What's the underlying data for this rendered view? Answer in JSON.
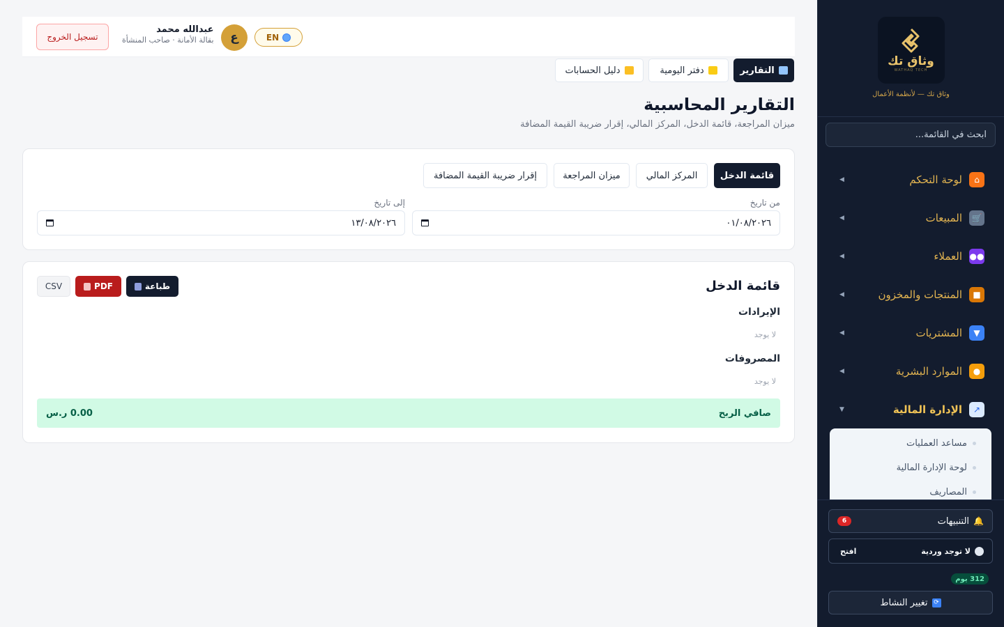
{
  "brand": {
    "logo_text": "وثاق تك",
    "logo_sub": "WATHAQ TECH",
    "tagline": "وثاق تك — لأنظمة الأعمال"
  },
  "sidebar": {
    "search_placeholder": "ابحث في القائمة...",
    "items": [
      {
        "label": "لوحة التحكم",
        "icon": "home-icon",
        "color": "#f97316"
      },
      {
        "label": "المبيعات",
        "icon": "cart-icon",
        "color": "#94a3b8"
      },
      {
        "label": "العملاء",
        "icon": "users-icon",
        "color": "#7c3aed"
      },
      {
        "label": "المنتجات والمخزون",
        "icon": "box-icon",
        "color": "#d97706"
      },
      {
        "label": "المشتريات",
        "icon": "inbox-icon",
        "color": "#3b82f6"
      },
      {
        "label": "الموارد البشرية",
        "icon": "person-icon",
        "color": "#f59e0b"
      },
      {
        "label": "الإدارة المالية",
        "icon": "chart-icon",
        "color": "#93c5fd"
      }
    ],
    "sub_items": [
      "مساعد العمليات",
      "لوحة الإدارة المالية",
      "المصاريف"
    ],
    "alerts_label": "التنبيهات",
    "alerts_count": "6",
    "shift_label": "لا توجد وردية",
    "open_label": "افتح",
    "days_label": "312 يوم",
    "change_activity_label": "تغيير النشاط"
  },
  "topbar": {
    "logout_label": "تسجيل الخروج",
    "user_initial": "ع",
    "user_name": "عبدالله محمد",
    "user_role": "بقالة الأمانة · صاحب المنشأة",
    "lang_label": "EN"
  },
  "page_tabs": [
    {
      "label": "التقارير",
      "active": true
    },
    {
      "label": "دفتر اليومية",
      "active": false
    },
    {
      "label": "دليل الحسابات",
      "active": false
    }
  ],
  "page": {
    "title": "التقارير المحاسبية",
    "subtitle": "ميزان المراجعة، قائمة الدخل، المركز المالي، إقرار ضريبة القيمة المضافة"
  },
  "report_tabs": [
    "قائمة الدخل",
    "المركز المالي",
    "ميزان المراجعة",
    "إقرار ضريبة القيمة المضافة"
  ],
  "filters": {
    "from_label": "من تاريخ",
    "from_value": "٠١/٠٨/٢٠٢٦",
    "to_label": "إلى تاريخ",
    "to_value": "١٣/٠٨/٢٠٢٦"
  },
  "report": {
    "title": "قائمة الدخل",
    "print_label": "طباعة",
    "pdf_label": "PDF",
    "csv_label": "CSV",
    "revenue_title": "الإيرادات",
    "revenue_empty": "لا يوجد",
    "expenses_title": "المصروفات",
    "expenses_empty": "لا يوجد",
    "net_label": "صافي الربح",
    "net_value": "0.00 ر.س"
  }
}
